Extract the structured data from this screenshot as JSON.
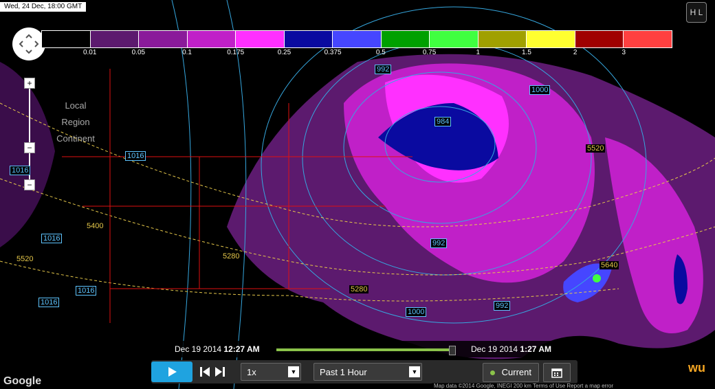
{
  "timestamp": "Wed, 24 Dec, 18:00 GMT",
  "hl_label": "H L",
  "zoom": {
    "plus": "+",
    "minus": "−",
    "levels": [
      "Local",
      "Region",
      "Continent"
    ]
  },
  "legend": {
    "colors": [
      "#000000",
      "#5c1a6e",
      "#8a1a9a",
      "#c020c8",
      "#ff30ff",
      "#0a0aa0",
      "#4646ff",
      "#00a000",
      "#40ff40",
      "#a0a000",
      "#ffff30",
      "#a00000",
      "#ff4040"
    ],
    "ticks": [
      "0.01",
      "0.05",
      "0.1",
      "0.175",
      "0.25",
      "0.375",
      "0.5",
      "0.75",
      "1",
      "1.5",
      "2",
      "3"
    ]
  },
  "map_labels": {
    "p992a": "992",
    "p1000a": "1000",
    "p984": "984",
    "h5520a": "5520",
    "p1016a": "1016",
    "p1016b": "1016",
    "h5400": "5400",
    "p1016c": "1016",
    "h5520b": "5520",
    "p1016d": "1016",
    "p1016e": "1016",
    "h5280a": "5280",
    "p992b": "992",
    "h5280b": "5280",
    "h5640": "5640",
    "p992c": "992",
    "p1000b": "1000"
  },
  "timeline": {
    "start_date": "Dec 19 2014",
    "start_time": "12:27 AM",
    "end_date": "Dec 19 2014",
    "end_time": "1:27 AM",
    "progress": 1.0
  },
  "controls": {
    "speed": "1x",
    "range": "Past 1 Hour",
    "current": "Current"
  },
  "footer": {
    "google": "Google",
    "attribution": "Map data ©2014 Google, INEGI   200 km   Terms of Use   Report a map error",
    "wu": "wu"
  }
}
